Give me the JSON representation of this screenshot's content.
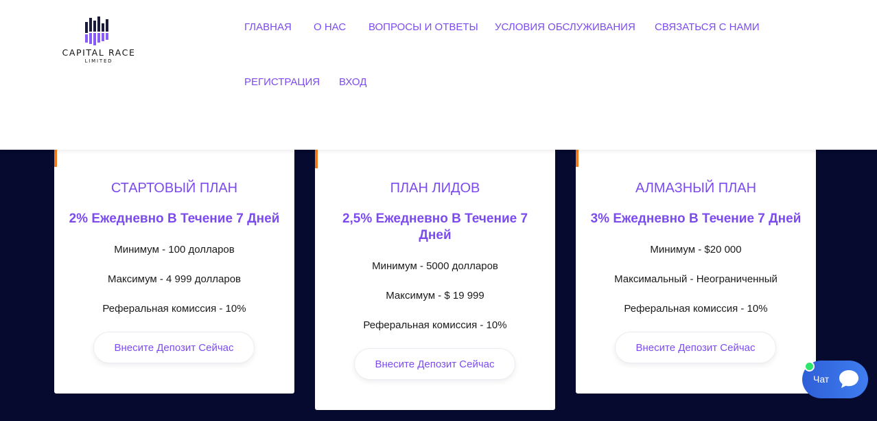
{
  "brand": {
    "name": "CAPITAL RACE",
    "subtitle": "LIMITED"
  },
  "nav": {
    "items": [
      "ГЛАВНАЯ",
      "О НАС",
      "ВОПРОСЫ И ОТВЕТЫ",
      "УСЛОВИЯ ОБСЛУЖИВАНИЯ",
      "СВЯЗАТЬСЯ С НАМИ",
      "РЕГИСТРАЦИЯ",
      "ВХОД"
    ]
  },
  "plans": [
    {
      "title": "СТАРТОВЫЙ ПЛАН",
      "rate": "2% Ежедневно В Течение 7 Дней",
      "min": "Минимум - 100 долларов",
      "max": "Максимум - 4 999 долларов",
      "referral": "Реферальная комиссия - 10%",
      "button": "Внесите Депозит Сейчас"
    },
    {
      "title": "ПЛАН ЛИДОВ",
      "rate": "2,5% Ежедневно В Течение 7 Дней",
      "min": "Минимум - 5000 долларов",
      "max": "Максимум - $ 19 999",
      "referral": "Реферальная комиссия - 10%",
      "button": "Внесите Депозит Сейчас"
    },
    {
      "title": "АЛМАЗНЫЙ ПЛАН",
      "rate": "3% Ежедневно В Течение 7 Дней",
      "min": "Минимум - $20 000",
      "max": "Максимальный - Неограниченный",
      "referral": "Реферальная комиссия - 10%",
      "button": "Внесите Депозит Сейчас"
    }
  ],
  "chat": {
    "label": "Чат",
    "icon": "chat-bubble-icon",
    "status": "online"
  },
  "colors": {
    "accent": "#7c4bf0",
    "background": "#050a2e",
    "card_accent": "#f07b1c",
    "chat": "#3f7df0",
    "online": "#2ee66b"
  }
}
